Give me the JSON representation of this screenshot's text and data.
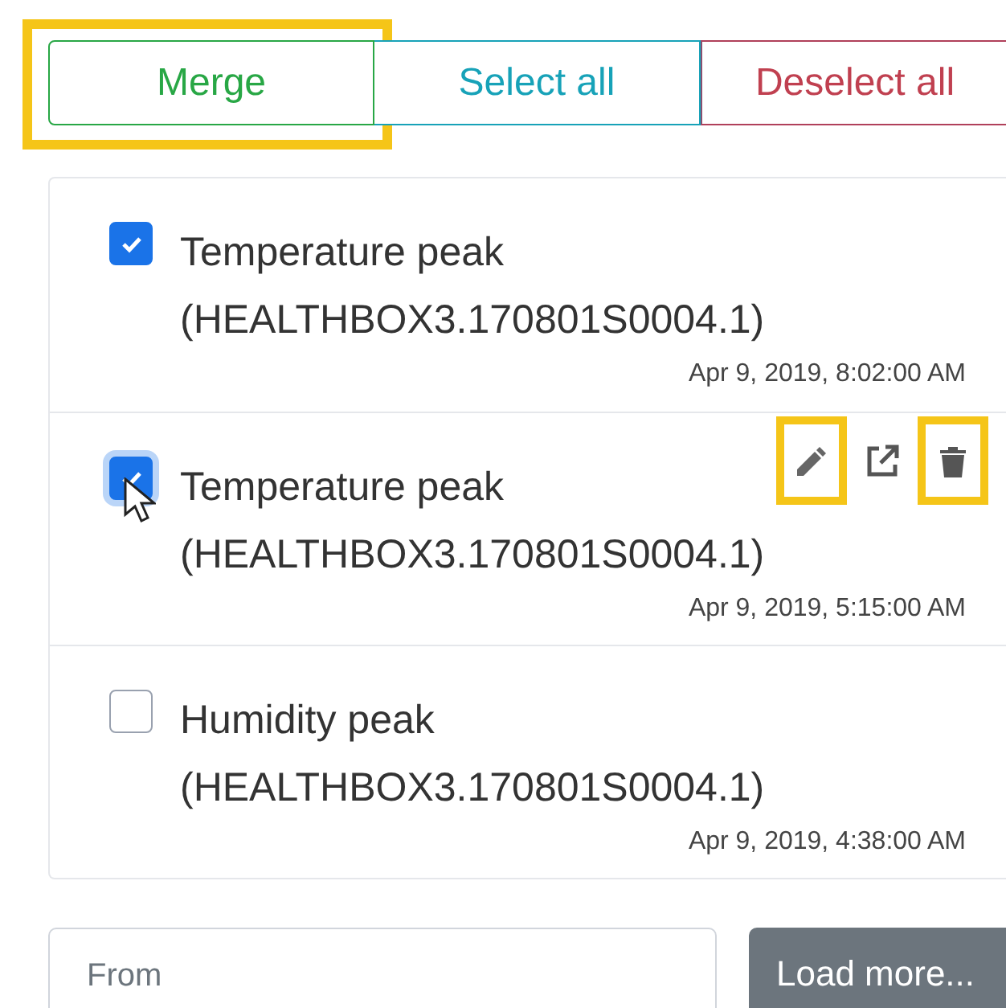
{
  "buttons": [
    {
      "label": "Merge",
      "kind": "success",
      "highlighted": true
    },
    {
      "label": "Select all",
      "kind": "info",
      "highlighted": false
    },
    {
      "label": "Deselect all",
      "kind": "danger",
      "highlighted": false
    }
  ],
  "events": [
    {
      "title": "Temperature peak",
      "source": "(HEALTHBOX3.170801S0004.1)",
      "time": "Apr 9, 2019, 8:02:00 AM",
      "checked": true,
      "focused": false,
      "hovered": false
    },
    {
      "title": "Temperature peak",
      "source": "(HEALTHBOX3.170801S0004.1)",
      "time": "Apr 9, 2019, 5:15:00 AM",
      "checked": true,
      "focused": true,
      "hovered": true,
      "actions": [
        {
          "kind": "edit",
          "highlighted": true
        },
        {
          "kind": "open",
          "highlighted": false
        },
        {
          "kind": "delete",
          "highlighted": true
        }
      ]
    },
    {
      "title": "Humidity peak",
      "source": "(HEALTHBOX3.170801S0004.1)",
      "time": "Apr 9, 2019, 4:38:00 AM",
      "checked": false,
      "focused": false,
      "hovered": false
    }
  ],
  "filter": {
    "placeholder": "From"
  },
  "load_more": {
    "label": "Load more..."
  }
}
